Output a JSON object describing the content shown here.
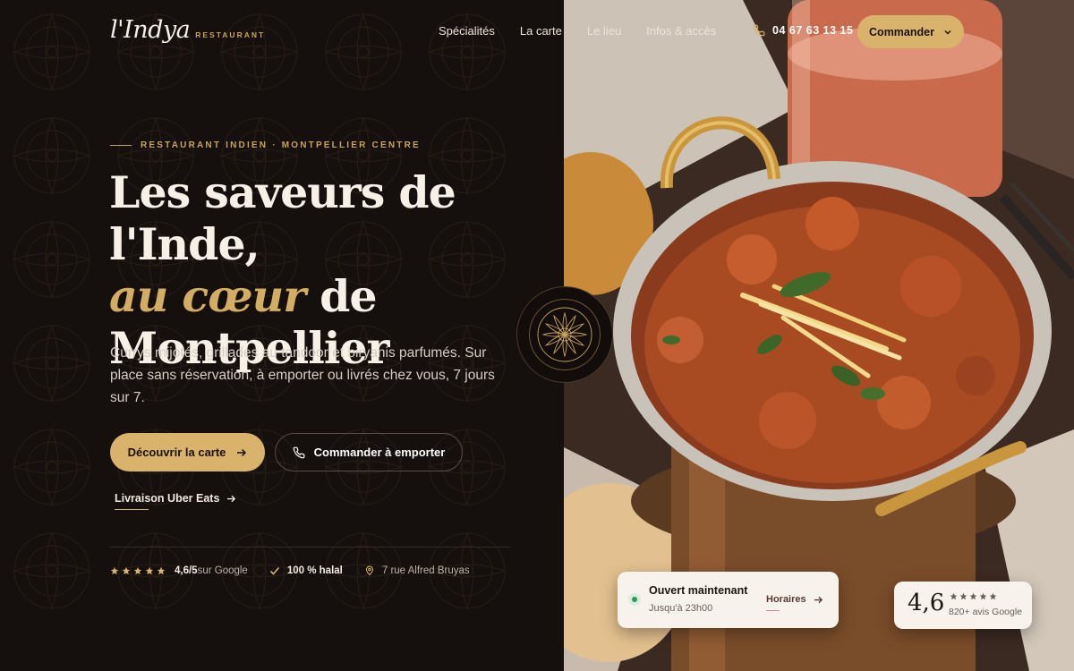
{
  "brand": {
    "name": "l'Indya",
    "sub": "RESTAURANT"
  },
  "nav": [
    {
      "label": "Spécialités"
    },
    {
      "label": "La carte"
    },
    {
      "label": "Le lieu"
    },
    {
      "label": "Infos & accès"
    }
  ],
  "header": {
    "phone": "04 67 63 13 15",
    "order_label": "Commander"
  },
  "hero": {
    "eyebrow": "RESTAURANT INDIEN · MONTPELLIER CENTRE",
    "title_line1": "Les saveurs de l'Inde,",
    "title_accent": "au cœur",
    "title_line2_rest": " de",
    "title_line3": "Montpellier",
    "lead": "Currys mijotés, grillades au tandoor et biryanis parfumés. Sur place sans réservation, à emporter ou livrés chez vous, 7 jours sur 7.",
    "primary_cta": "Découvrir la carte",
    "secondary_cta": "Commander à emporter",
    "uber": "Livraison Uber Eats"
  },
  "meta": {
    "rating": "4,6/5",
    "rating_suffix": " sur Google",
    "halal": "100 % halal",
    "address": "7 rue Alfred Bruyas"
  },
  "status_card": {
    "title": "Ouvert maintenant",
    "subtitle": "Jusqu'à 23h00",
    "link": "Horaires"
  },
  "rating_card": {
    "value": "4,6",
    "subtitle": "820+ avis Google"
  },
  "colors": {
    "gold": "#d9b26b",
    "bg": "#150f0d",
    "open": "#2e9a57"
  }
}
